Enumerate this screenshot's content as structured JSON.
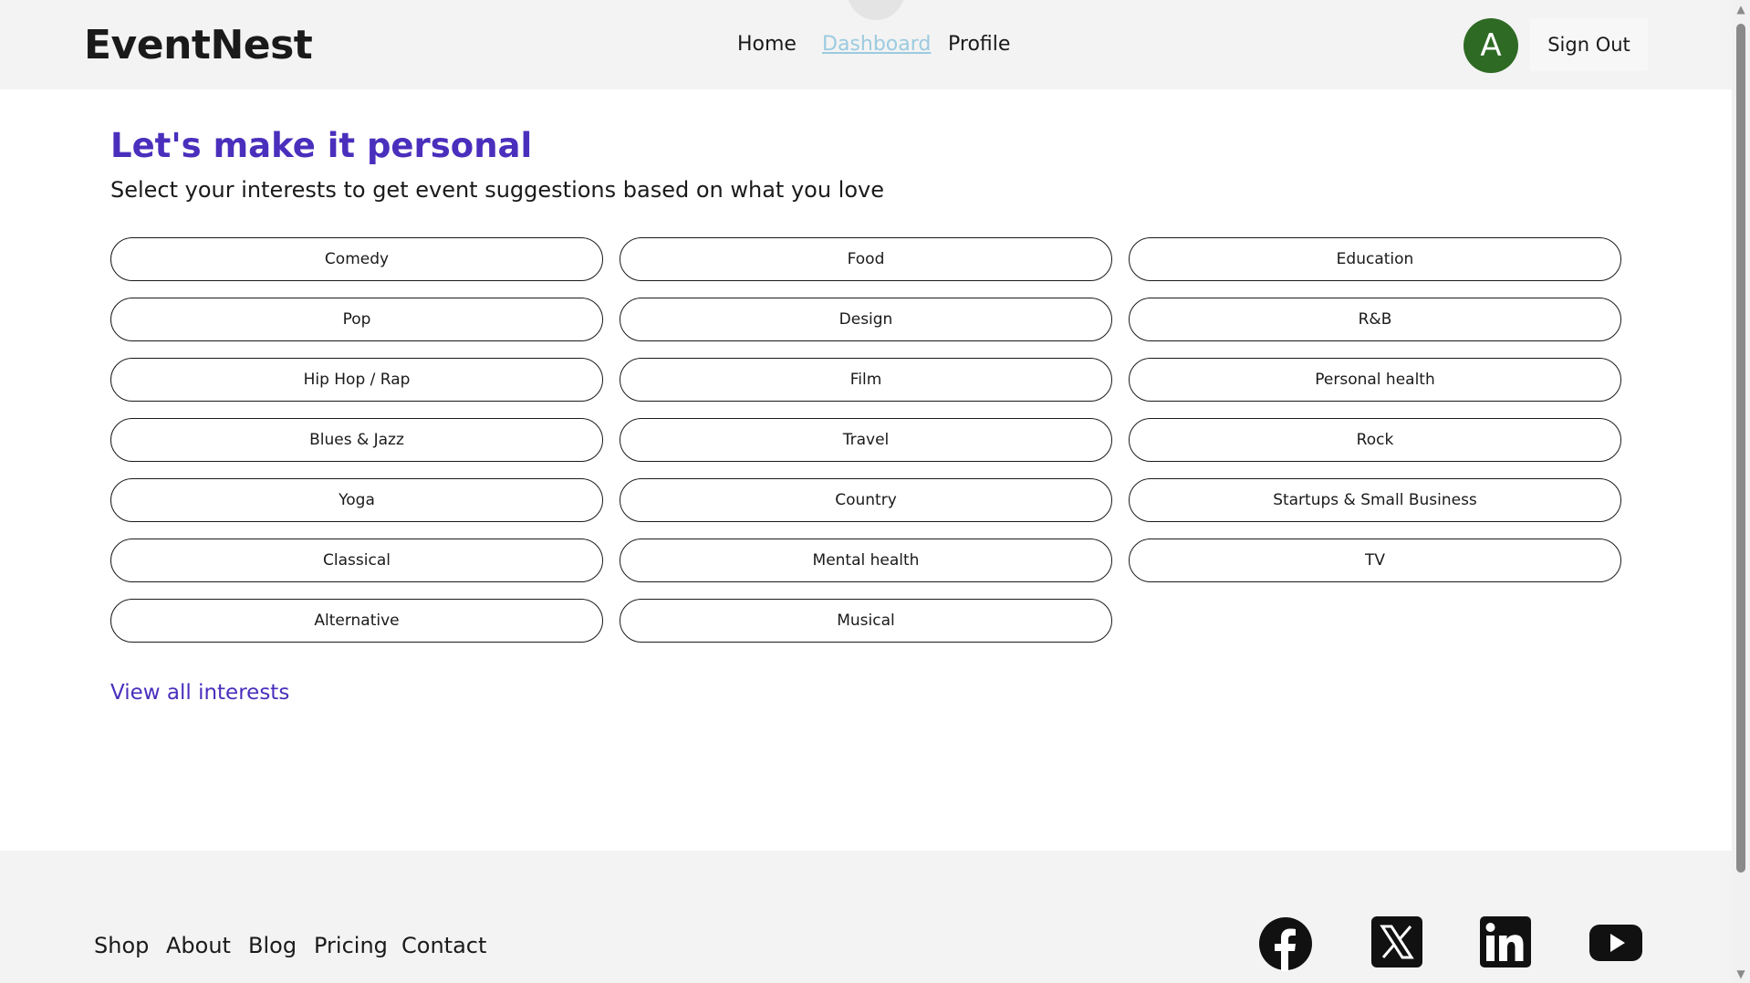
{
  "app": {
    "brand": "EventNest"
  },
  "nav": {
    "items": [
      {
        "label": "Home",
        "active": false
      },
      {
        "label": "Dashboard",
        "active": true
      },
      {
        "label": "Profile",
        "active": false
      }
    ]
  },
  "user": {
    "avatar_initial": "A",
    "avatar_color": "#2e6a24"
  },
  "header": {
    "sign_out_label": "Sign Out"
  },
  "main": {
    "title": "Let's make it personal",
    "subtitle": "Select your interests to get event suggestions based on what you love",
    "interests": [
      "Comedy",
      "Food",
      "Education",
      "Pop",
      "Design",
      "R&B",
      "Hip Hop / Rap",
      "Film",
      "Personal health",
      "Blues & Jazz",
      "Travel",
      "Rock",
      "Yoga",
      "Country",
      "Startups & Small Business",
      "Classical",
      "Mental health",
      "TV",
      "Alternative",
      "Musical"
    ],
    "view_all_label": "View all interests"
  },
  "footer": {
    "links": [
      "Shop",
      "About",
      "Blog",
      "Pricing",
      "Contact"
    ],
    "social": [
      "facebook-icon",
      "x-twitter-icon",
      "linkedin-icon",
      "youtube-icon"
    ]
  },
  "colors": {
    "accent": "#4a2fbd",
    "nav_active": "#9ccbe0",
    "surface": "#f3f3f3"
  }
}
